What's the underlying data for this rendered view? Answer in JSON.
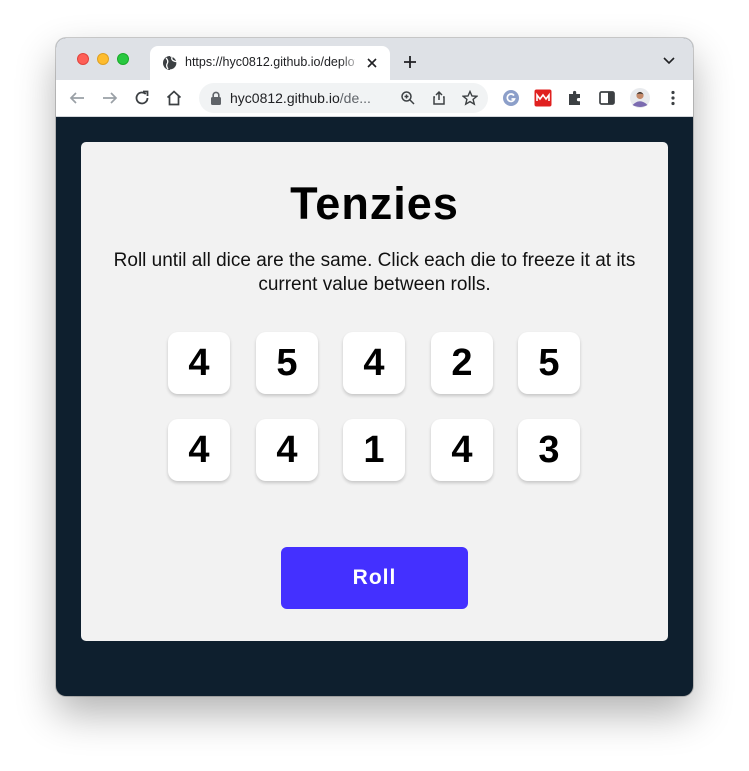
{
  "browser": {
    "tab": {
      "title": "https://hyc0812.github.io/deploy",
      "favicon": "globe-icon"
    },
    "address_bar": {
      "host": "hyc0812.github.io",
      "path": "/de..."
    },
    "colors": {
      "tabbar": "#dee1e6",
      "toolbar": "#ffffff",
      "omnibox": "#f1f3f4"
    },
    "extensions": [
      "grammarly-icon",
      "mendeley-icon",
      "puzzle-icon",
      "sidepanel-icon",
      "profile-avatar"
    ]
  },
  "app": {
    "title": "Tenzies",
    "instructions": "Roll until all dice are the same. Click each die to freeze it at its current value between rolls.",
    "dice": [
      4,
      5,
      4,
      2,
      5,
      4,
      4,
      1,
      4,
      3
    ],
    "roll_label": "Roll",
    "colors": {
      "page_background": "#0e1f2e",
      "card_background": "#f2f2f2",
      "die_background": "#ffffff",
      "button_background": "#4430ff"
    }
  }
}
